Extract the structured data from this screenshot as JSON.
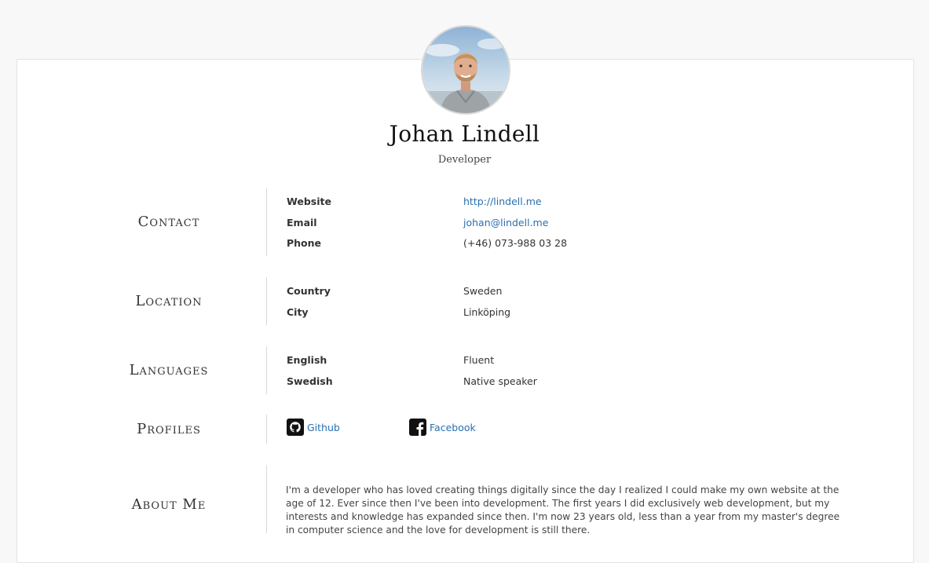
{
  "profile": {
    "name": "Johan Lindell",
    "role": "Developer"
  },
  "sections": {
    "contact": {
      "title": "Contact",
      "rows": [
        {
          "label": "Website",
          "value": "http://lindell.me"
        },
        {
          "label": "Email",
          "value": "johan@lindell.me"
        },
        {
          "label": "Phone",
          "value": "(+46) 073-988 03 28"
        }
      ]
    },
    "location": {
      "title": "Location",
      "rows": [
        {
          "label": "Country",
          "value": "Sweden"
        },
        {
          "label": "City",
          "value": "Linköping"
        }
      ]
    },
    "languages": {
      "title": "Languages",
      "rows": [
        {
          "label": "English",
          "value": "Fluent"
        },
        {
          "label": "Swedish",
          "value": "Native speaker"
        }
      ]
    },
    "profiles": {
      "title": "Profiles",
      "items": [
        {
          "label": "Github",
          "icon": "github-icon"
        },
        {
          "label": "Facebook",
          "icon": "facebook-icon"
        }
      ]
    },
    "about": {
      "title": "About Me",
      "text": "I'm a developer who has loved creating things digitally since the day I realized I could make my own website at the age of 12. Ever since then I've been into development. The first years I did exclusively web development, but my interests and knowledge has expanded since then. I'm now 23 years old, less than a year from my master's degree in computer science and the love for development is still there."
    }
  },
  "colors": {
    "link": "#2a6fb0",
    "background": "#f8f8f8",
    "card": "#ffffff"
  }
}
